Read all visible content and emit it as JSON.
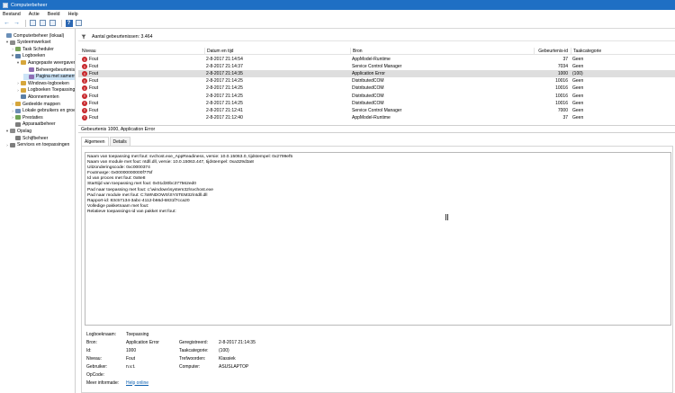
{
  "window": {
    "title": "Computerbeheer"
  },
  "menu": [
    "Bestand",
    "Actie",
    "Beeld",
    "Help"
  ],
  "tree": [
    {
      "label": "Computerbeheer (lokaal)",
      "level": 0,
      "expander": "",
      "icon_color": "#6a8fb8"
    },
    {
      "label": "Systeemwerkset",
      "level": 1,
      "expander": "▾",
      "icon_color": "#8c8c8c"
    },
    {
      "label": "Task Scheduler",
      "level": 2,
      "expander": "›",
      "icon_color": "#7aa35b"
    },
    {
      "label": "Logboeken",
      "level": 2,
      "expander": "▾",
      "icon_color": "#5b7fa6"
    },
    {
      "label": "Aangepaste weergaven",
      "level": 3,
      "expander": "▾",
      "icon_color": "#d6a63c"
    },
    {
      "label": "Beheergebeurtenissen",
      "level": 4,
      "expander": "",
      "icon_color": "#8f6fb3"
    },
    {
      "label": "Pagina met samenvatting",
      "level": 4,
      "expander": "",
      "icon_color": "#8f6fb3",
      "selected": true
    },
    {
      "label": "Windows-logboeken",
      "level": 3,
      "expander": "›",
      "icon_color": "#d6a63c"
    },
    {
      "label": "Logboeken Toepassingen",
      "level": 3,
      "expander": "›",
      "icon_color": "#d6a63c"
    },
    {
      "label": "Abonnementen",
      "level": 3,
      "expander": "",
      "icon_color": "#5b7fa6"
    },
    {
      "label": "Gedeelde mappen",
      "level": 2,
      "expander": "›",
      "icon_color": "#d6a63c"
    },
    {
      "label": "Lokale gebruikers en groepen",
      "level": 2,
      "expander": "›",
      "icon_color": "#6c8cb4"
    },
    {
      "label": "Prestaties",
      "level": 2,
      "expander": "›",
      "icon_color": "#6fa356"
    },
    {
      "label": "Apparaatbeheer",
      "level": 2,
      "expander": "",
      "icon_color": "#7d7d7d"
    },
    {
      "label": "Opslag",
      "level": 1,
      "expander": "▾",
      "icon_color": "#8c8c8c"
    },
    {
      "label": "Schijfbeheer",
      "level": 2,
      "expander": "",
      "icon_color": "#7d7d7d"
    },
    {
      "label": "Services en toepassingen",
      "level": 1,
      "expander": "›",
      "icon_color": "#7d7d7d"
    }
  ],
  "events_header": "Aantal gebeurtenissen: 3.464",
  "columns": [
    "Niveau",
    "Datum en tijd",
    "Bron",
    "Gebeurtenis-id",
    "Taakcategorie"
  ],
  "rows": [
    {
      "level": "Fout",
      "datetime": "2-8-2017 21:14:54",
      "source": "AppModel-Runtime",
      "event_id": "37",
      "category": "Geen"
    },
    {
      "level": "Fout",
      "datetime": "2-8-2017 21:14:37",
      "source": "Service Control Manager",
      "event_id": "7034",
      "category": "Geen"
    },
    {
      "level": "Fout",
      "datetime": "2-8-2017 21:14:35",
      "source": "Application Error",
      "event_id": "1000",
      "category": "(100)",
      "selected": true
    },
    {
      "level": "Fout",
      "datetime": "2-8-2017 21:14:25",
      "source": "DistributedCOM",
      "event_id": "10016",
      "category": "Geen"
    },
    {
      "level": "Fout",
      "datetime": "2-8-2017 21:14:25",
      "source": "DistributedCOM",
      "event_id": "10016",
      "category": "Geen"
    },
    {
      "level": "Fout",
      "datetime": "2-8-2017 21:14:25",
      "source": "DistributedCOM",
      "event_id": "10016",
      "category": "Geen"
    },
    {
      "level": "Fout",
      "datetime": "2-8-2017 21:14:25",
      "source": "DistributedCOM",
      "event_id": "10016",
      "category": "Geen"
    },
    {
      "level": "Fout",
      "datetime": "2-8-2017 21:12:41",
      "source": "Service Control Manager",
      "event_id": "7000",
      "category": "Geen"
    },
    {
      "level": "Fout",
      "datetime": "2-8-2017 21:12:40",
      "source": "AppModel-Runtime",
      "event_id": "37",
      "category": "Geen"
    }
  ],
  "detail_title": "Gebeurtenis 1000, Application Error",
  "tabs": [
    "Algemeen",
    "Details"
  ],
  "message_lines": [
    "Naam van toepassing met fout: svchost.exe_AppReadiness, versie: 10.0.15063.0, tijdstempel: 0x2799ef5",
    "Naam van module met fout: ntdll.dll, versie: 10.0.15063.447, tijdstempel: 0xa329d3a8",
    "Uitzonderingscode: 0xc0000374",
    "Foutmarge: 0x00000000000f775f",
    "Id van proces met fout: 0x8e8",
    "Starttijd van toepassing met fout: 0x01d30bc377562ed0",
    "Pad naar toepassing met fout: c:\\windows\\system32\\svchost.exe",
    "Pad naar module met fout: C:\\WINDOWS\\SYSTEM32\\ntdll.dll",
    "Rapport-id: 83c57134-3abc-4112-b66d-6831f7cca20",
    "Volledige pakketnaam met fout:",
    "Relatieve toepassings-id van pakket met fout:"
  ],
  "properties": {
    "logname_label": "Logboeknaam:",
    "logname_value": "Toepassing",
    "source_label": "Bron:",
    "source_value": "Application Error",
    "id_label": "Id:",
    "id_value": "1000",
    "level_label": "Niveau:",
    "level_value": "Fout",
    "user_label": "Gebruiker:",
    "user_value": "n.v.t.",
    "opcode_label": "OpCode:",
    "opcode_value": "",
    "moreinfo_label": "Meer informatie:",
    "moreinfo_link": "Help online",
    "logged_label": "Geregistreerd:",
    "logged_value": "2-8-2017 21:14:35",
    "task_label": "Taakcategorie:",
    "task_value": "(100)",
    "keywords_label": "Trefwoorden:",
    "keywords_value": "Klassiek",
    "computer_label": "Computer:",
    "computer_value": "ASUSLAPTOP"
  },
  "colors": {
    "titlebar": "#1f6fc4",
    "error": "#c7262b",
    "selection": "#cce4f7",
    "link": "#0b5fb0"
  }
}
